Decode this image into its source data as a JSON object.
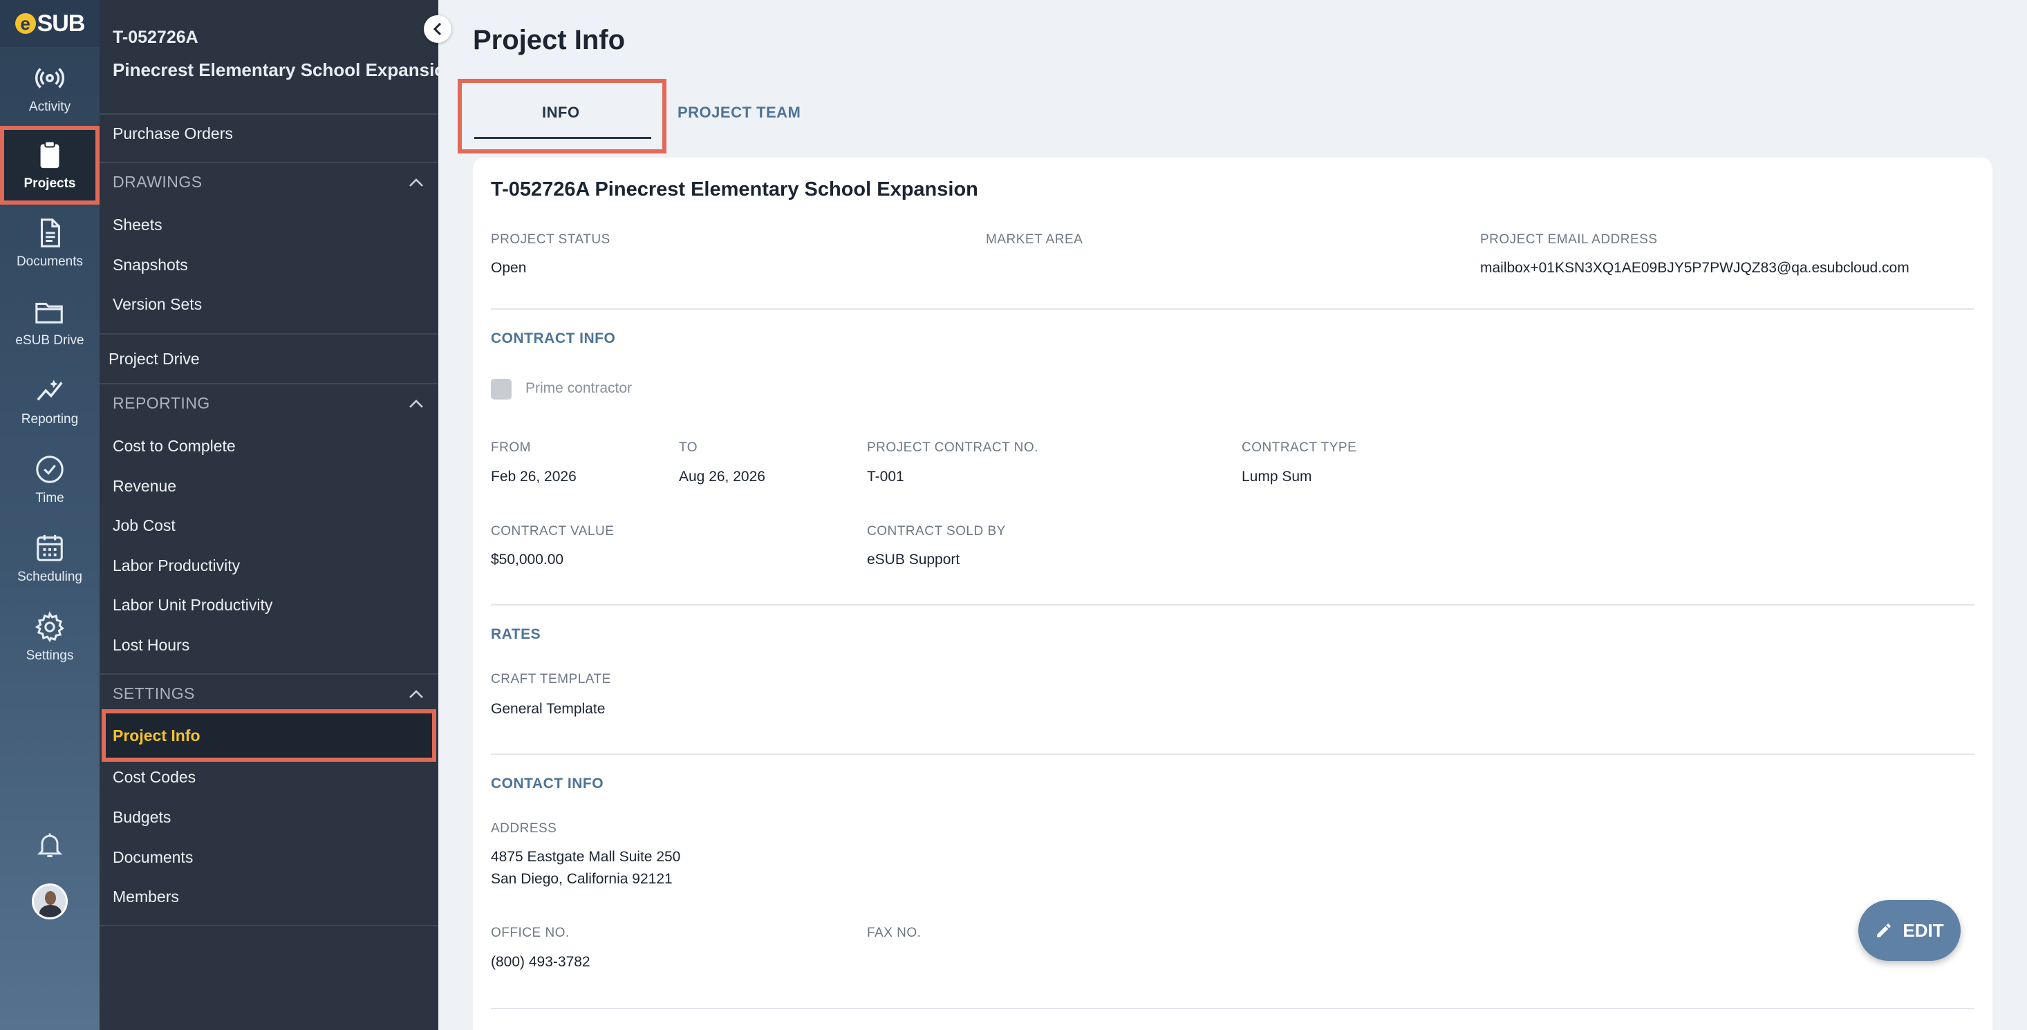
{
  "rail": {
    "logo_e": "e",
    "logo_text": "SUB",
    "items": [
      {
        "label": "Activity",
        "icon": "activity-icon"
      },
      {
        "label": "Projects",
        "icon": "clipboard-icon"
      },
      {
        "label": "Documents",
        "icon": "document-icon"
      },
      {
        "label": "eSUB Drive",
        "icon": "folder-icon"
      },
      {
        "label": "Reporting",
        "icon": "chart-icon"
      },
      {
        "label": "Time",
        "icon": "clock-icon"
      },
      {
        "label": "Scheduling",
        "icon": "calendar-icon"
      },
      {
        "label": "Settings",
        "icon": "gear-icon"
      }
    ],
    "active": "Projects",
    "accent_color": "#e06a57"
  },
  "nav": {
    "project_id": "T-052726A",
    "project_name": "Pinecrest Elementary School Expansion",
    "purchase_orders": "Purchase Orders",
    "drawings": {
      "title": "DRAWINGS",
      "items": [
        "Sheets",
        "Snapshots",
        "Version Sets"
      ]
    },
    "project_drive": "Project Drive",
    "reporting": {
      "title": "REPORTING",
      "items": [
        "Cost to Complete",
        "Revenue",
        "Job Cost",
        "Labor Productivity",
        "Labor Unit Productivity",
        "Lost Hours"
      ]
    },
    "settings": {
      "title": "SETTINGS",
      "active": "Project Info",
      "items": [
        "Cost Codes",
        "Budgets",
        "Documents",
        "Members"
      ]
    },
    "active_color": "#f2c230"
  },
  "main": {
    "title": "Project Info",
    "tabs": [
      "INFO",
      "PROJECT TEAM"
    ],
    "active_tab": "INFO",
    "card_title": "T-052726A Pinecrest Elementary School Expansion",
    "project_status_label": "PROJECT STATUS",
    "project_status": "Open",
    "market_area_label": "MARKET AREA",
    "email_label": "PROJECT EMAIL ADDRESS",
    "email": "mailbox+01KSN3XQ1AE09BJY5P7PWJQZ83@qa.esubcloud.com",
    "contract_info": {
      "title": "CONTRACT INFO",
      "prime_contractor": "Prime contractor",
      "from_label": "FROM",
      "from": "Feb 26, 2026",
      "to_label": "TO",
      "to": "Aug 26, 2026",
      "contract_no_label": "PROJECT CONTRACT NO.",
      "contract_no": "T-001",
      "contract_type_label": "CONTRACT TYPE",
      "contract_type": "Lump Sum",
      "contract_value_label": "CONTRACT VALUE",
      "contract_value": "$50,000.00",
      "sold_by_label": "CONTRACT SOLD BY",
      "sold_by": "eSUB Support"
    },
    "rates": {
      "title": "RATES",
      "craft_template_label": "CRAFT TEMPLATE",
      "craft_template": "General Template"
    },
    "contact_info": {
      "title": "CONTACT INFO",
      "address_label": "ADDRESS",
      "address_line1": "4875 Eastgate Mall Suite 250",
      "address_line2": "San Diego, California 92121",
      "office_label": "OFFICE NO.",
      "office": "(800) 493-3782",
      "fax_label": "FAX NO."
    },
    "edit_button": "EDIT"
  }
}
